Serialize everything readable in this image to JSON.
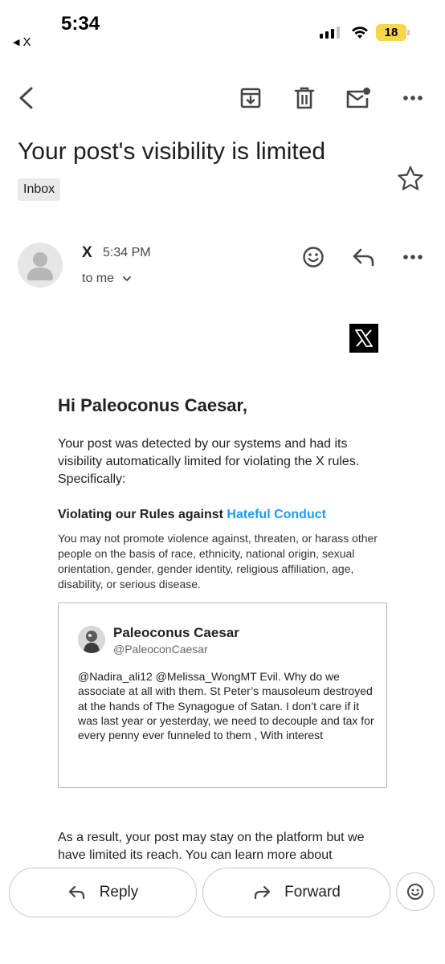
{
  "status_bar": {
    "time": "5:34",
    "back_app": "X",
    "battery": "18"
  },
  "toolbar": {
    "icons": [
      "back-arrow-icon",
      "archive-icon",
      "trash-icon",
      "mark-unread-icon",
      "more-vert-icon"
    ]
  },
  "email": {
    "subject": "Your post's visibility is limited",
    "label": "Inbox",
    "sender": "X",
    "time": "5:34 PM",
    "recipient": "to me"
  },
  "body": {
    "greeting": "Hi Paleoconus Caesar,",
    "intro": "Your post was detected by our systems and had its visibility automatically limited for violating the X rules. Specifically:",
    "violation_prefix": "Violating our Rules against ",
    "violation_link": "Hateful Conduct",
    "policy": "You may not promote violence against, threaten, or harass other people on the basis of race, ethnicity, national origin, sexual orientation, gender, gender identity, religious affiliation, age, disability, or serious disease.",
    "tweet": {
      "name": "Paleoconus Caesar",
      "handle": "@PaleoconCaesar",
      "text": "@Nadira_ali12 @Melissa_WongMT Evil. Why do we associate at all with them. St Peter’s mausoleum destroyed at the hands of The Synagogue of Satan. I don’t care if it was last year or yesterday, we need to decouple and tax for every penny ever funneled to them , With interest"
    },
    "result": "As a result, your post may stay on the platform but we have limited its reach. You can learn more about"
  },
  "actions": {
    "reply": "Reply",
    "forward": "Forward"
  },
  "colors": {
    "link": "#1d9bf0",
    "battery": "#f5d64a",
    "chip_bg": "#e9e9e9"
  }
}
